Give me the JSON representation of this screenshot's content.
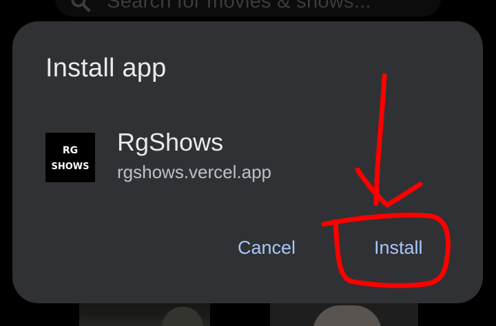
{
  "background": {
    "search_placeholder": "Search for movies & shows..."
  },
  "dialog": {
    "title": "Install app",
    "app": {
      "icon_text_line1": "RG",
      "icon_text_line2": "SHOWS",
      "name": "RgShows",
      "url": "rgshows.vercel.app"
    },
    "buttons": {
      "cancel": "Cancel",
      "install": "Install"
    }
  },
  "colors": {
    "dialog_bg": "#303134",
    "title_text": "#e8eaed",
    "secondary_text": "#bdc1c6",
    "button_text": "#a8c7fa",
    "annotation": "#ff0000"
  },
  "icons": {
    "search": "search-icon",
    "annotation_arrow": "arrow-down-annotation",
    "annotation_circle": "circle-annotation"
  }
}
